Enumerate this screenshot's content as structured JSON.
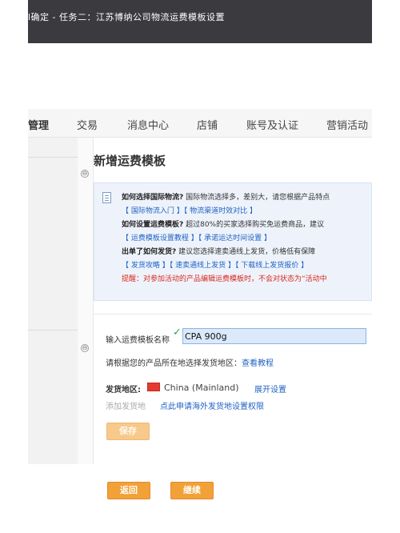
{
  "title_bar": {
    "text": "l确定 - 任务二：江苏博纳公司物流运费模板设置"
  },
  "nav": {
    "items": [
      "管理",
      "交易",
      "消息中心",
      "店铺",
      "账号及认证",
      "营销活动"
    ]
  },
  "section_icons": [
    "⊖",
    "⊖"
  ],
  "page_heading": "新增运费模板",
  "info": {
    "q1_label": "如何选择国际物流?",
    "q1_text": "国际物流选择多，差别大，请您根据产品特点",
    "q1_links": "【 国际物流入门 】【 物流渠道时效对比 】",
    "q2_label": "如何设置运费模板?",
    "q2_text": "超过80%的买家选择购买免运费商品，建议",
    "q2_links": "【 运费模板设置教程 】【 承诺运达时间设置 】",
    "q3_label": "出单了如何发货?",
    "q3_text": "建议您选择速卖通线上发货，价格低有保障",
    "q3_links": "【 发货攻略 】【 速卖通线上发货 】【 下载线上发货报价 】",
    "warning": "提醒：对参加活动的产品编辑运费模板时，不会对状态为“活动中"
  },
  "form": {
    "name_label": "输入运费模板名称",
    "name_value": "CPA 900g",
    "hint_text": "请根据您的产品所在地选择发货地区：",
    "hint_link": "查看教程",
    "region_label": "发货地区:",
    "region_value": "China (Mainland)",
    "expand_link": "展开设置",
    "add_region_label": "添加发货地",
    "apply_link": "点此申请海外发货地设置权限",
    "save_label": "保存"
  },
  "footer": {
    "back_label": "返回",
    "continue_label": "继续"
  },
  "colors": {
    "accent": "#f2a136",
    "link": "#1f62c3",
    "warning": "#d9281c",
    "title_bar": "#3a3a3f"
  }
}
